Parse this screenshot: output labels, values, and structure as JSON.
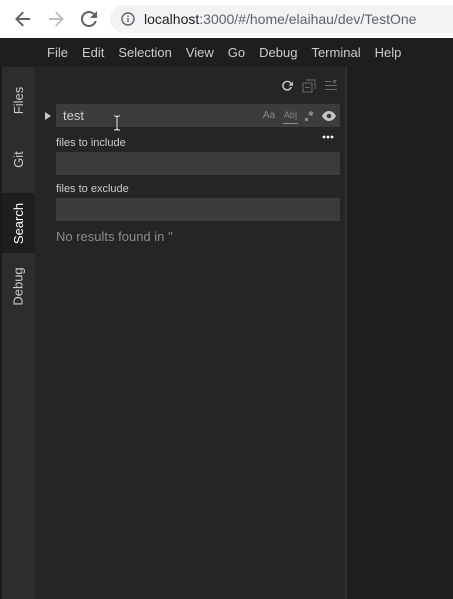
{
  "browser": {
    "url_host": "localhost",
    "url_rest": ":3000/#/home/elaihau/dev/TestOne",
    "icons": {
      "back": "arrow-left-icon",
      "forward": "arrow-right-icon",
      "reload": "reload-icon",
      "info": "info-icon"
    }
  },
  "menu": {
    "items": [
      "File",
      "Edit",
      "Selection",
      "View",
      "Go",
      "Debug",
      "Terminal",
      "Help"
    ]
  },
  "activity_bar": {
    "tabs": [
      "Files",
      "Git",
      "Search",
      "Debug"
    ],
    "active": "Search"
  },
  "search": {
    "query": "test",
    "options": {
      "match_case": "Aa",
      "whole_word": "Ab|",
      "regex": "regex-icon",
      "show_preview": "eye-icon"
    },
    "toolbar_icons": [
      "refresh-icon",
      "collapse-all-icon",
      "clear-results-icon"
    ],
    "files_to_include_label": "files to include",
    "files_to_include_value": "",
    "files_to_exclude_label": "files to exclude",
    "files_to_exclude_value": "",
    "result_message": "No results found in ''"
  },
  "colors": {
    "ide_bg": "#1e1e1e",
    "sidebar_bg": "#252526",
    "activity_bg": "#2d2d2d",
    "input_bg": "#3c3c3c",
    "text": "#cccccc"
  }
}
